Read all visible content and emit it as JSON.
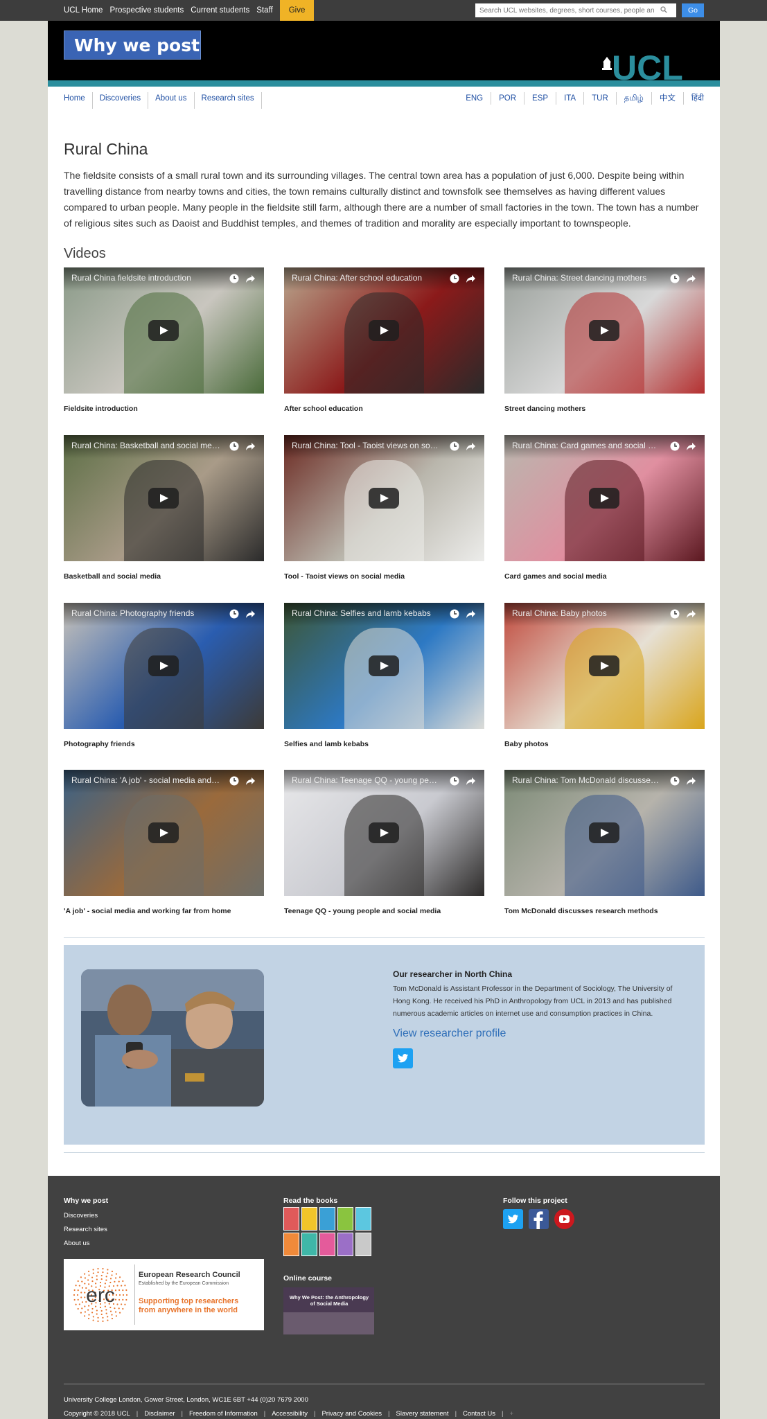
{
  "topbar": {
    "links": [
      "UCL Home",
      "Prospective students",
      "Current students",
      "Staff"
    ],
    "give": "Give",
    "search_placeholder": "Search UCL websites, degrees, short courses, people an",
    "go": "Go"
  },
  "header": {
    "site_title": "Why we post",
    "ucl": "UCL"
  },
  "nav": {
    "items": [
      "Home",
      "Discoveries",
      "About us",
      "Research sites"
    ],
    "languages": [
      "ENG",
      "POR",
      "ESP",
      "ITA",
      "TUR",
      "தமிழ்",
      "中文",
      "हिंदी"
    ]
  },
  "page": {
    "title": "Rural China",
    "intro": "The fieldsite consists of a small rural town and its surrounding villages. The central town area has a population of just 6,000. Despite being within travelling distance from nearby towns and cities, the town remains culturally distinct and townsfolk see themselves as having different values compared to urban people. Many people in the fieldsite still farm, although there are a number of small factories in the town. The town has a number of religious sites such as Daoist and Buddhist temples, and themes of tradition and morality are especially important to townspeople.",
    "videos_heading": "Videos"
  },
  "videos": [
    {
      "title": "Rural China fieldsite introduction",
      "caption": "Fieldsite introduction",
      "colors": [
        "#8a9a88",
        "#c9c6bf",
        "#4a6b3a"
      ]
    },
    {
      "title": "Rural China: After school education",
      "caption": "After school education",
      "colors": [
        "#b9a68d",
        "#8b1a1a",
        "#2a2a2a"
      ]
    },
    {
      "title": "Rural China: Street dancing mothers",
      "caption": "Street dancing mothers",
      "colors": [
        "#9aa09b",
        "#d8d8d8",
        "#b43030"
      ]
    },
    {
      "title": "Rural China: Basketball and social media",
      "caption": "Basketball and social media",
      "colors": [
        "#5d6f46",
        "#a99b88",
        "#2b2b2b"
      ]
    },
    {
      "title": "Rural China: Tool - Taoist views on social media",
      "caption": "Tool - Taoist views on social media",
      "colors": [
        "#6b2a22",
        "#b9b6ac",
        "#ececea"
      ]
    },
    {
      "title": "Rural China: Card games and social media",
      "caption": "Card games and social media",
      "colors": [
        "#b9b7ae",
        "#e08fa0",
        "#5b1820"
      ]
    },
    {
      "title": "Rural China: Photography friends",
      "caption": "Photography friends",
      "colors": [
        "#c9c3b9",
        "#2a5db0",
        "#3c3a37"
      ]
    },
    {
      "title": "Rural China: Selfies and lamb kebabs",
      "caption": "Selfies and lamb kebabs",
      "colors": [
        "#3d5636",
        "#2d79c4",
        "#dcdcd8"
      ]
    },
    {
      "title": "Rural China: Baby photos",
      "caption": "Baby photos",
      "colors": [
        "#c04a3d",
        "#e6e0d4",
        "#d9a51c"
      ]
    },
    {
      "title": "Rural China: 'A job' - social media and working far from home",
      "caption": "'A job' - social media and working far from home",
      "colors": [
        "#3b6185",
        "#9a6a3c",
        "#6e6e68"
      ]
    },
    {
      "title": "Rural China: Teenage QQ - young people and social media",
      "caption": "Teenage QQ - young people and social media",
      "colors": [
        "#e8e8ea",
        "#c9cad0",
        "#2d2b2a"
      ]
    },
    {
      "title": "Rural China: Tom McDonald discusses research methods",
      "caption": "Tom McDonald discusses research methods",
      "colors": [
        "#7c8a76",
        "#b6b3ab",
        "#3e5a8a"
      ]
    }
  ],
  "researcher": {
    "heading": "Our researcher in North China",
    "text": "Tom McDonald is Assistant Professor in the Department of Sociology, The University of Hong Kong. He received his PhD in Anthropology from UCL in 2013 and has published numerous academic articles on internet use and consumption practices in China.",
    "link": "View researcher profile"
  },
  "footer": {
    "col1_heading": "Why we post",
    "col1_links": [
      "Discoveries",
      "Research sites",
      "About us"
    ],
    "erc_title": "European Research Council",
    "erc_sub": "Established by the European Commission",
    "erc_tag": "Supporting top researchers from anywhere in the world",
    "erc_logo": "erc",
    "col2_heading": "Read the books",
    "online_heading": "Online course",
    "online_title": "Why We Post: the Anthropology of Social Media",
    "col3_heading": "Follow this project",
    "address": "University College London, Gower Street, London, WC1E 6BT +44 (0)20 7679 2000",
    "legal": [
      "Copyright © 2018 UCL",
      "Disclaimer",
      "Freedom of Information",
      "Accessibility",
      "Privacy and Cookies",
      "Slavery statement",
      "Contact Us"
    ]
  },
  "book_colors": [
    "#e05a5a",
    "#f1c52a",
    "#3aa0d6",
    "#8ac43f",
    "#5cc7e0",
    "#f08a3a",
    "#3fb7a8",
    "#e45b9b",
    "#9b6fc7",
    "#c9c9c9"
  ],
  "icons": {
    "search": "search-icon",
    "clock": "clock-icon",
    "share": "share-icon",
    "play": "play-icon",
    "twitter": "twitter-icon",
    "facebook": "facebook-icon",
    "youtube": "youtube-icon"
  }
}
